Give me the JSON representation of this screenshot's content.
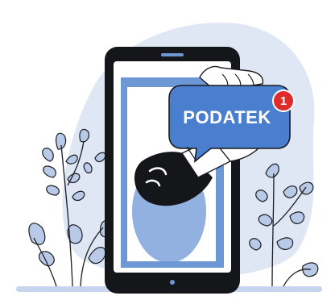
{
  "notification": {
    "label": "PODATEK",
    "badge_count": "1"
  },
  "colors": {
    "blob": "#dfe6f4",
    "leaves": "#b9c9e8",
    "phone_frame": "#15161a",
    "screen": "#ffffff",
    "screen_panel": "#6e97d6",
    "bubble": "#4a7fd0",
    "badge": "#e02b2b",
    "ground": "#c6d4ee"
  },
  "icons": [
    "notification-badge-icon",
    "speech-bubble-icon",
    "hand-illustration",
    "phone-illustration",
    "plant-illustration"
  ]
}
